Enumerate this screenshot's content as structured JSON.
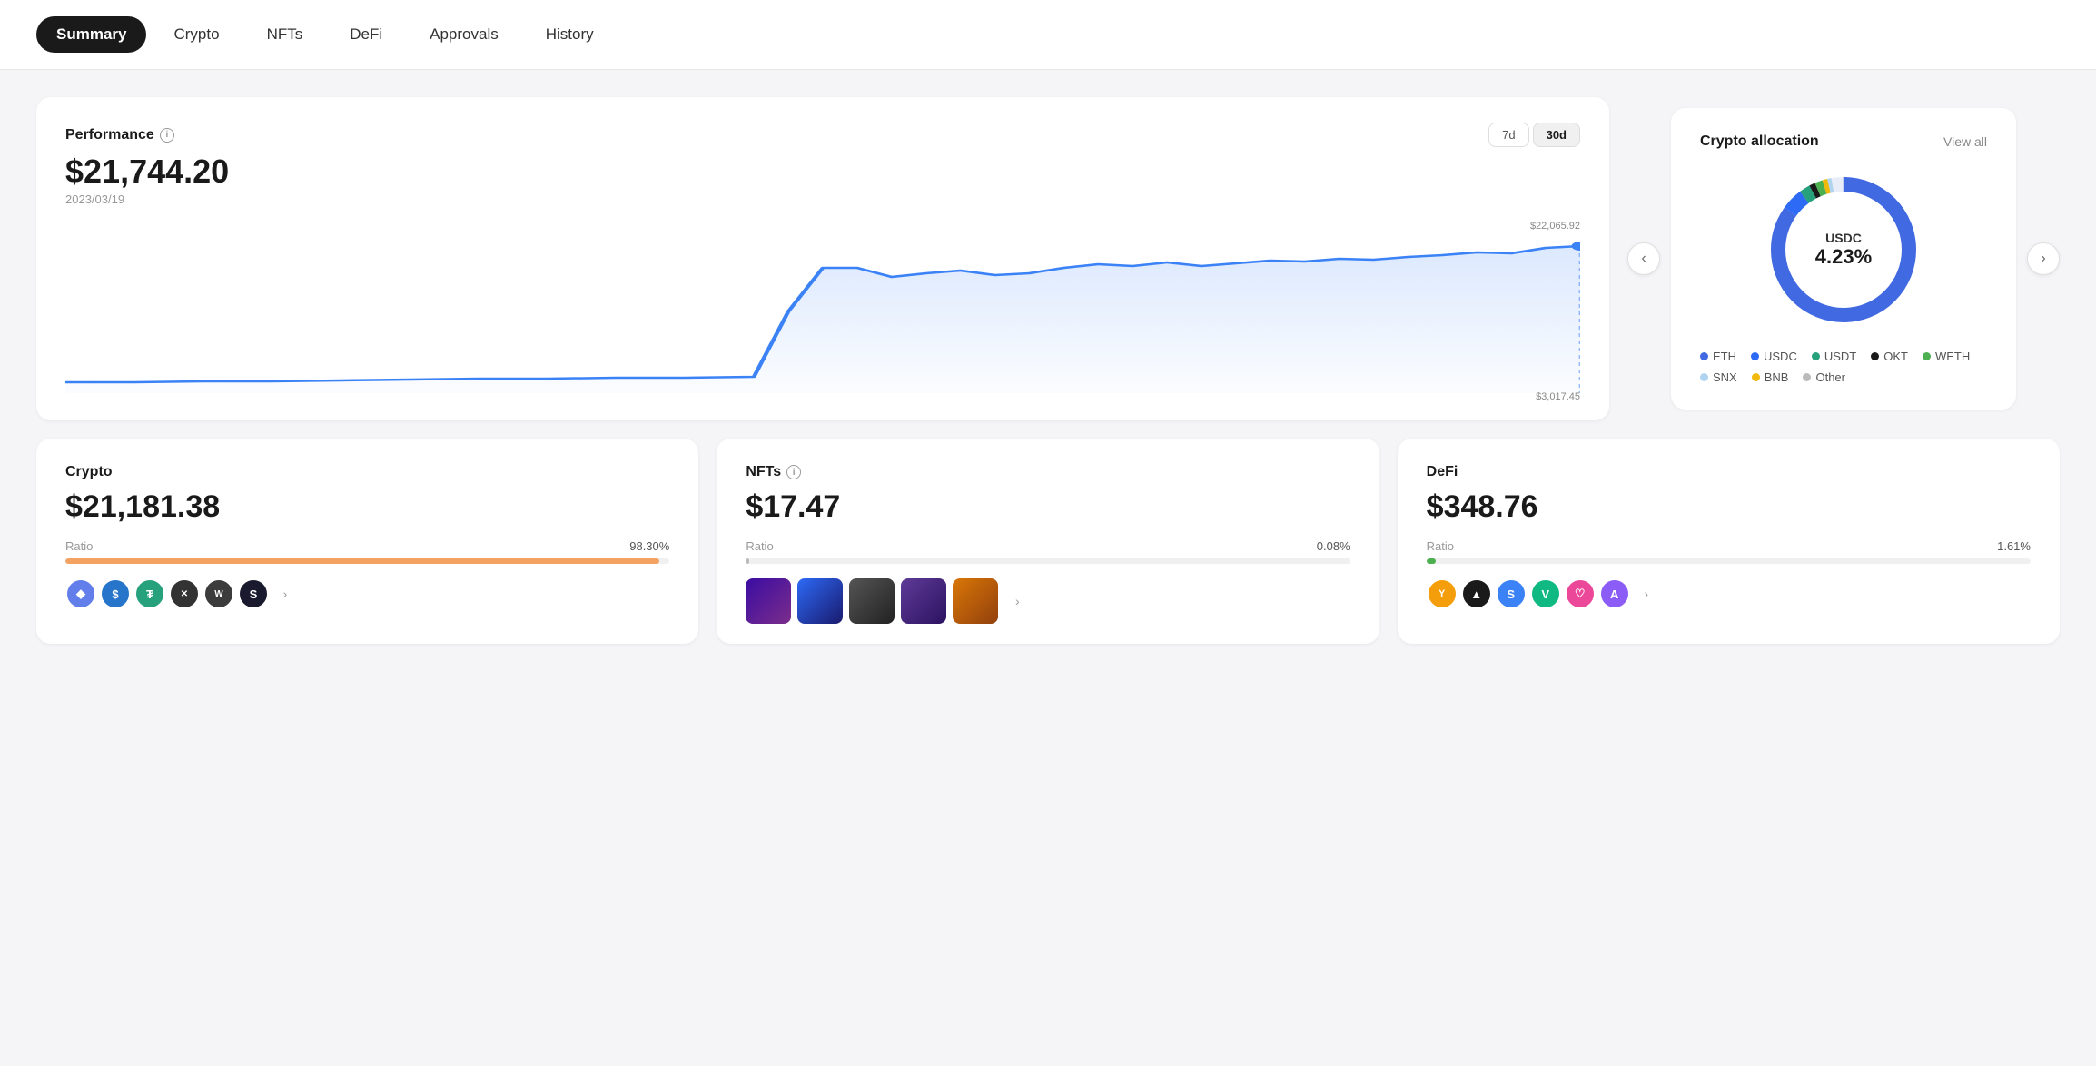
{
  "nav": {
    "items": [
      {
        "label": "Summary",
        "active": true
      },
      {
        "label": "Crypto",
        "active": false
      },
      {
        "label": "NFTs",
        "active": false
      },
      {
        "label": "DeFi",
        "active": false
      },
      {
        "label": "Approvals",
        "active": false
      },
      {
        "label": "History",
        "active": false
      }
    ]
  },
  "performance": {
    "title": "Performance",
    "amount": "$21,744.20",
    "date": "2023/03/19",
    "high_label": "$22,065.92",
    "low_label": "$3,017.45",
    "periods": [
      "7d",
      "30d"
    ],
    "active_period": "30d"
  },
  "crypto_allocation": {
    "title": "Crypto allocation",
    "view_all": "View all",
    "center_label": "USDC",
    "center_pct": "4.23%",
    "legend": [
      {
        "name": "ETH",
        "color": "#4169e1"
      },
      {
        "name": "USDC",
        "color": "#2d6af6"
      },
      {
        "name": "USDT",
        "color": "#26a17b"
      },
      {
        "name": "OKT",
        "color": "#1a1a1a"
      },
      {
        "name": "WETH",
        "color": "#4caf50"
      },
      {
        "name": "SNX",
        "color": "#b0d4f0"
      },
      {
        "name": "BNB",
        "color": "#f0b90b"
      },
      {
        "name": "Other",
        "color": "#bbb"
      }
    ]
  },
  "crypto_summary": {
    "title": "Crypto",
    "amount": "$21,181.38",
    "ratio_label": "Ratio",
    "ratio_pct": "98.30%",
    "bar_color": "#f4a261",
    "bar_width": "98.30"
  },
  "nfts_summary": {
    "title": "NFTs",
    "amount": "$17.47",
    "ratio_label": "Ratio",
    "ratio_pct": "0.08%",
    "bar_color": "#bbb",
    "bar_width": "0.08"
  },
  "defi_summary": {
    "title": "DeFi",
    "amount": "$348.76",
    "ratio_label": "Ratio",
    "ratio_pct": "1.61%",
    "bar_color": "#4caf50",
    "bar_width": "1.61"
  }
}
